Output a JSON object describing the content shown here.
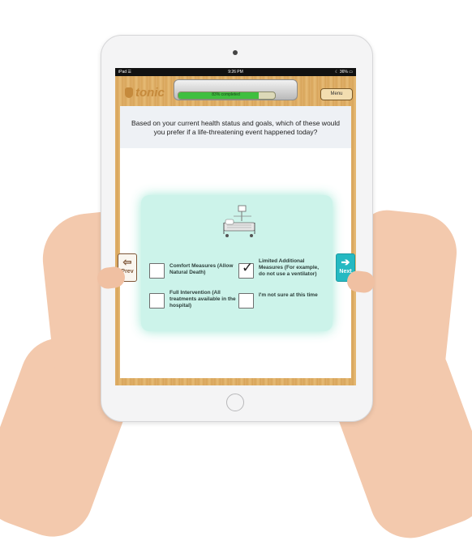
{
  "status_bar": {
    "carrier": "iPad ☰",
    "time": "9:26 PM",
    "battery": "☾ 36% ▭"
  },
  "app": {
    "logo": "tonic"
  },
  "progress": {
    "label": "83% completed",
    "fraction": 0.83
  },
  "menu": {
    "label": "Menu"
  },
  "question": {
    "text": "Based on your current health status and goals, which of these would you prefer if a life-threatening event happened today?"
  },
  "options": [
    {
      "label": "Comfort Measures (Allow Natural Death)",
      "checked": false
    },
    {
      "label": "Limited Additional Measures (For example, do not use a ventilator)",
      "checked": true
    },
    {
      "label": "Full Intervention (All treatments available in the hospital)",
      "checked": false
    },
    {
      "label": "I'm not sure at this time",
      "checked": false
    }
  ],
  "nav": {
    "prev": {
      "label": "Prev",
      "icon": "arrow-left-icon"
    },
    "next": {
      "label": "Next",
      "icon": "arrow-right-icon"
    }
  },
  "illustration": {
    "icon": "hospital-bed-icon"
  },
  "colors": {
    "accent": "#25b9c2",
    "progress": "#3fbf3f",
    "card": "#ccf3ea",
    "wood": "#d9a65c"
  }
}
